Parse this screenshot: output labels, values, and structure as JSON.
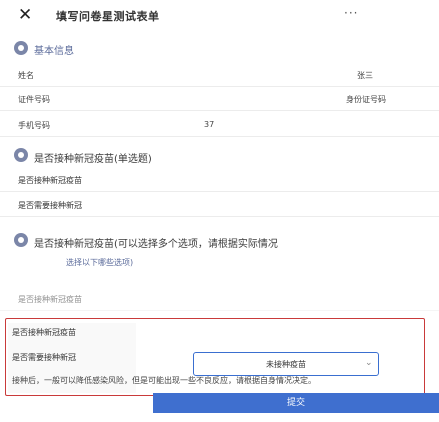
{
  "header": {
    "close_icon": "close-icon",
    "title": "填写问卷星测试表单",
    "more_icon": "more-icon"
  },
  "sections": {
    "basic": {
      "label": "基本信息",
      "rows": [
        {
          "label": "姓名",
          "value": "张三"
        },
        {
          "label": "证件号码",
          "value": "身份证号码"
        },
        {
          "label": "手机号码",
          "value": "37"
        }
      ]
    },
    "q1": {
      "label": "是否接种新冠疫苗(单选题)",
      "options": [
        "是否接种新冠疫苗",
        "是否需要接种新冠"
      ]
    },
    "q2": {
      "label": "是否接种新冠疫苗(可以选择多个选项，请根据实际情况",
      "note": "选择以下哪些选项)",
      "options": [
        "是否接种新冠疫苗",
        "是否需要接种新冠"
      ]
    }
  },
  "popup": {
    "select_value": "未接种疫苗",
    "description": "接种后，一般可以降低感染风险，但是可能出现一些不良反应，请根据自身情况决定。"
  },
  "footer": {
    "submit_label": "提交"
  }
}
